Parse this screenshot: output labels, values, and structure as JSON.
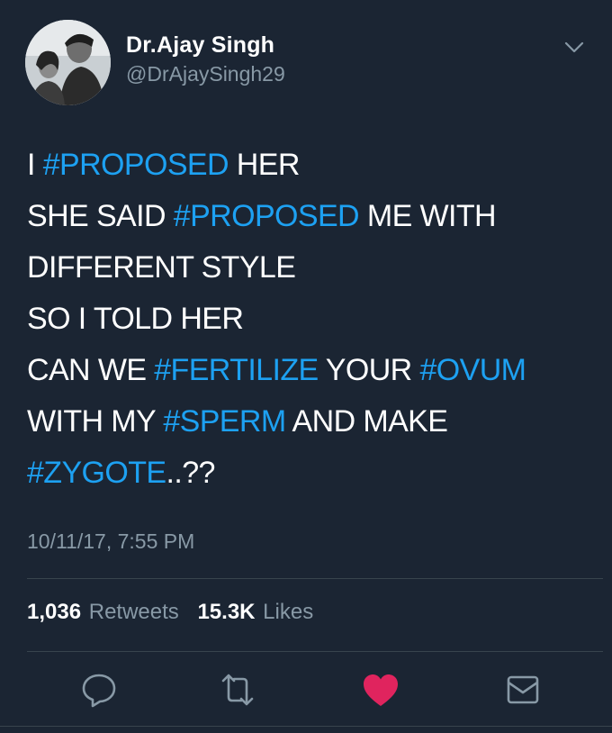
{
  "user": {
    "display_name": "Dr.Ajay Singh",
    "handle": "@DrAjaySingh29",
    "avatar_icon": "profile-photo"
  },
  "tweet": {
    "lines": [
      [
        {
          "t": "I "
        },
        {
          "t": "#PROPOSED",
          "tag": true
        },
        {
          "t": " HER"
        }
      ],
      [
        {
          "t": "SHE SAID "
        },
        {
          "t": "#PROPOSED",
          "tag": true
        },
        {
          "t": " ME WITH"
        }
      ],
      [
        {
          "t": "DIFFERENT STYLE"
        }
      ],
      [
        {
          "t": "SO I TOLD HER"
        }
      ],
      [
        {
          "t": "CAN WE "
        },
        {
          "t": "#FERTILIZE",
          "tag": true
        },
        {
          "t": " YOUR "
        },
        {
          "t": "#OVUM",
          "tag": true
        }
      ],
      [
        {
          "t": "WITH MY "
        },
        {
          "t": "#SPERM",
          "tag": true
        },
        {
          "t": " AND MAKE"
        }
      ],
      [
        {
          "t": "#ZYGOTE",
          "tag": true
        },
        {
          "t": "..??"
        }
      ]
    ],
    "timestamp": "10/11/17, 7:55 PM"
  },
  "stats": {
    "retweets_count": "1,036",
    "retweets_label": "Retweets",
    "likes_count": "15.3K",
    "likes_label": "Likes"
  },
  "actions": [
    "reply-icon",
    "retweet-icon",
    "heart-icon",
    "message-icon"
  ],
  "colors": {
    "background": "#1b2533",
    "hashtag": "#1da1f2",
    "secondary_text": "#8899a6",
    "like_active": "#e0245e",
    "divider": "#38444d"
  }
}
